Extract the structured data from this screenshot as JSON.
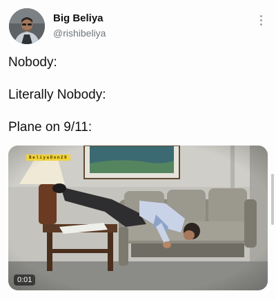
{
  "tweet": {
    "display_name": "Big Beliya",
    "handle": "@rishibeliya",
    "lines": [
      "Nobody:",
      "Literally Nobody:",
      "Plane on 9/11:"
    ],
    "media": {
      "watermark": "BeliyaDon29",
      "duration": "0:01"
    }
  },
  "icons": {
    "more": "more-vertical-icon"
  }
}
